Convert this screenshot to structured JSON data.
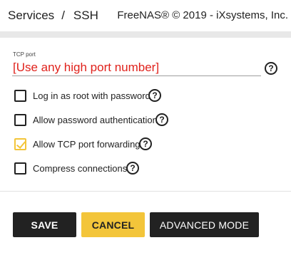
{
  "header": {
    "breadcrumb": {
      "parent": "Services",
      "separator": "/",
      "current": "SSH"
    },
    "copyright": "FreeNAS® © 2019 - iXsystems, Inc."
  },
  "form": {
    "tcp_port": {
      "label": "TCP port",
      "value": "",
      "placeholder": "[Use any high port number]"
    },
    "options": [
      {
        "label": "Log in as root with password",
        "checked": false
      },
      {
        "label": "Allow password authentication",
        "checked": false
      },
      {
        "label": "Allow TCP port forwarding",
        "checked": true
      },
      {
        "label": "Compress connections",
        "checked": false
      }
    ],
    "help_icon_glyph": "?"
  },
  "actions": {
    "save_label": "SAVE",
    "cancel_label": "CANCEL",
    "advanced_label": "ADVANCED MODE"
  },
  "colors": {
    "accent": "#f3c53a",
    "primary": "#222222",
    "error_text": "#e0221c"
  }
}
